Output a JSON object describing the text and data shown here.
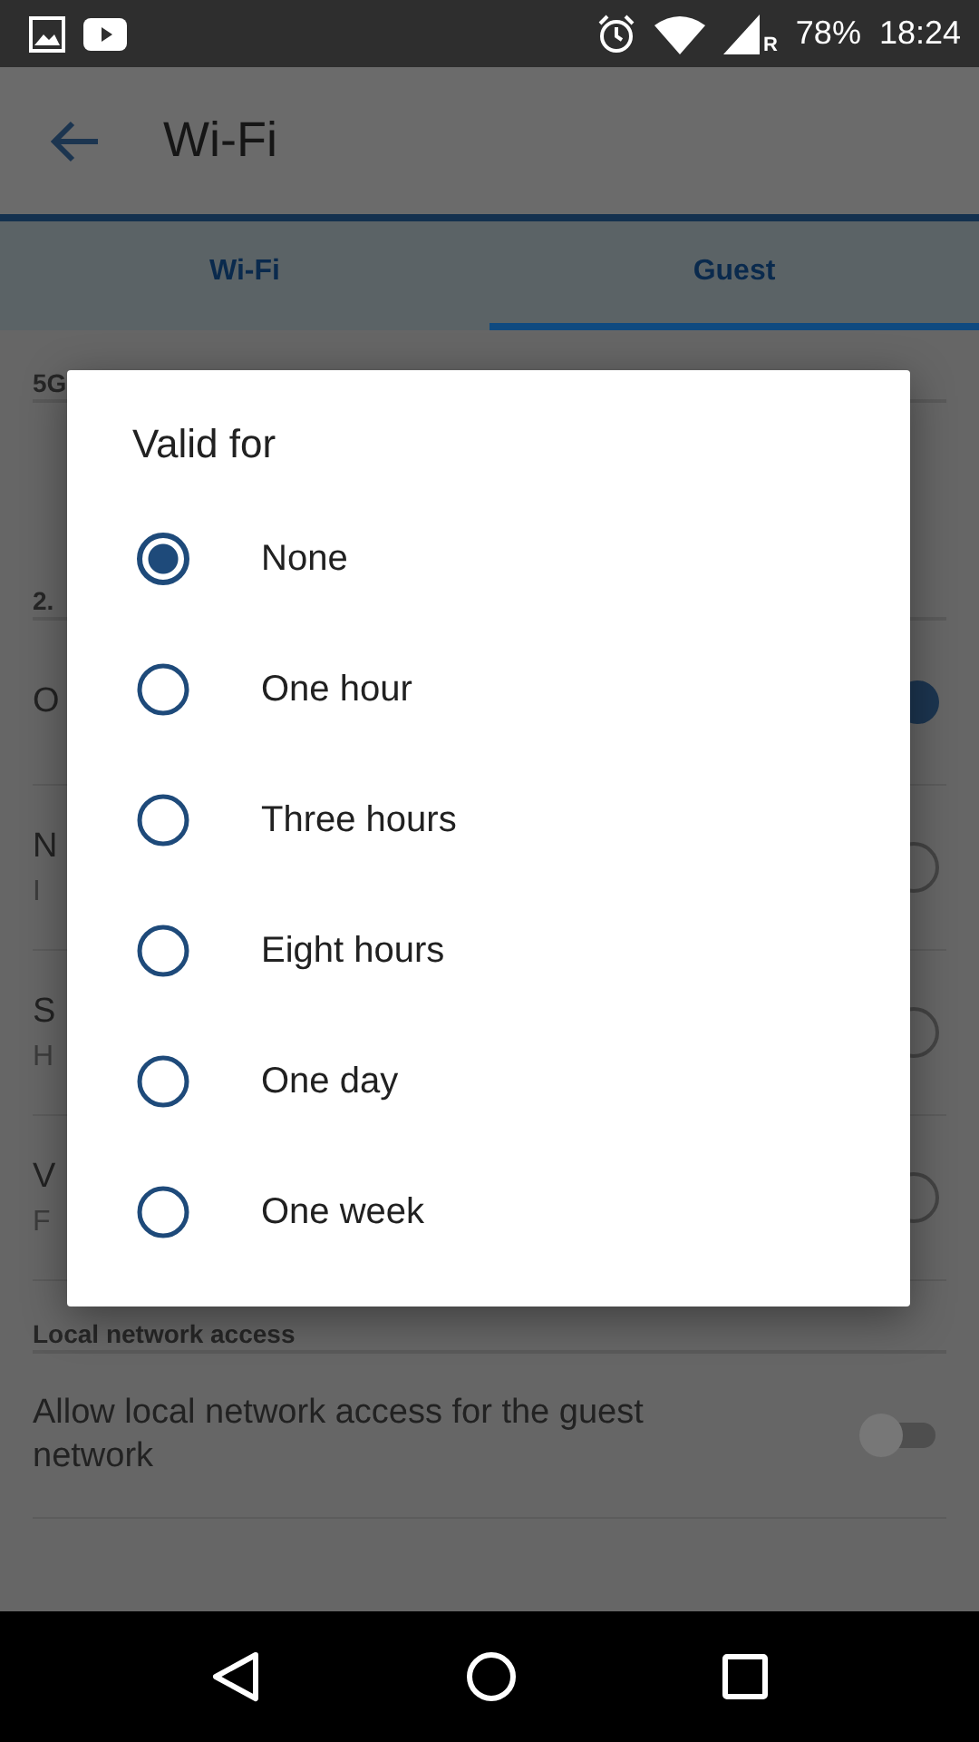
{
  "status_bar": {
    "roaming": "R",
    "battery": "78%",
    "time": "18:24"
  },
  "app_bar": {
    "title": "Wi-Fi"
  },
  "tabs": [
    {
      "label": "Wi-Fi",
      "selected": false
    },
    {
      "label": "Guest",
      "selected": true
    }
  ],
  "sections": [
    {
      "header": "5G"
    },
    {
      "header": "2.",
      "rows": [
        {
          "kind": "toggle",
          "title": "O",
          "on": true
        },
        {
          "kind": "radio",
          "title": "N",
          "subtitle": "I",
          "selected": false
        },
        {
          "kind": "radio",
          "title": "S",
          "subtitle": "H",
          "selected": false
        },
        {
          "kind": "radio",
          "title": "V",
          "subtitle": "F",
          "selected": false
        }
      ]
    },
    {
      "header": "Local network access",
      "rows": [
        {
          "kind": "toggle",
          "title": "Allow local network access for the guest network",
          "on": false
        }
      ]
    }
  ],
  "dialog": {
    "title": "Valid for",
    "options": [
      {
        "label": "None",
        "selected": true
      },
      {
        "label": "One hour",
        "selected": false
      },
      {
        "label": "Three hours",
        "selected": false
      },
      {
        "label": "Eight hours",
        "selected": false
      },
      {
        "label": "One day",
        "selected": false
      },
      {
        "label": "One week",
        "selected": false
      }
    ]
  }
}
